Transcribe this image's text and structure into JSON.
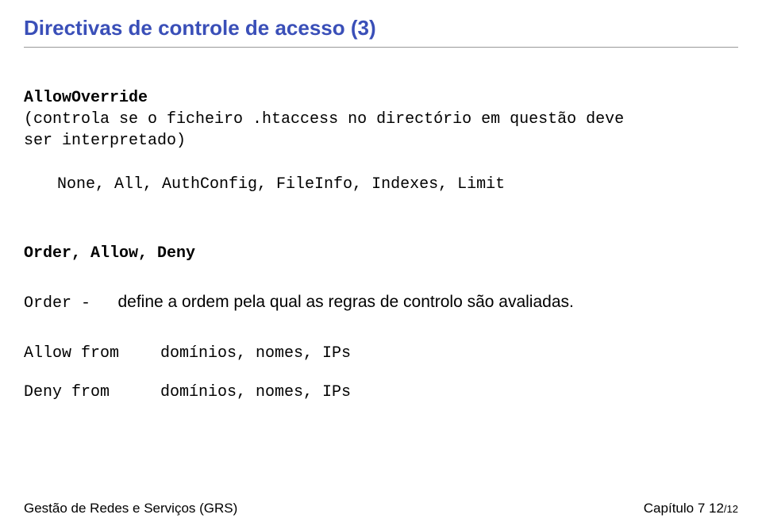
{
  "title": "Directivas de controle de acesso (3)",
  "allowoverride": {
    "label": "AllowOverride",
    "desc_line1": "(controla se o ficheiro .htaccess no directório em questão deve",
    "desc_line2": "ser interpretado)"
  },
  "none_line": "None, All, AuthConfig, FileInfo, Indexes, Limit",
  "order": {
    "heading": "Order, Allow, Deny",
    "row_left": "Order   -",
    "row_right": "define a ordem pela qual as regras de controlo são avaliadas.",
    "allow_left": "Allow from",
    "allow_right": "domínios, nomes, IPs",
    "deny_left": "Deny from",
    "deny_right": "domínios, nomes, IPs"
  },
  "footer": {
    "left": "Gestão de Redes e Serviços (GRS)",
    "right_prefix": "Capítulo 7 12",
    "right_total": "/12"
  }
}
